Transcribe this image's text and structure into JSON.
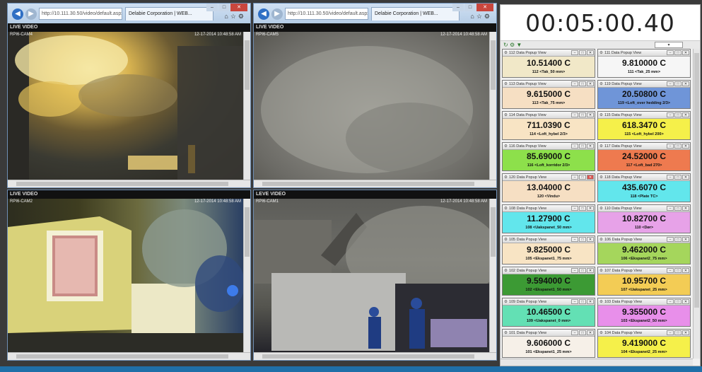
{
  "browser": {
    "address": "http://10.111.30.50/video/default.aspx",
    "tab_title": "Delabie Corporation | WEB...",
    "header": "LIVE VIDEO",
    "header_alt": "LEVE VIDEO"
  },
  "videos": [
    {
      "cam": "RPI6-CAM4",
      "stamp": "12-17-2014 10:48:58 AM"
    },
    {
      "cam": "RPI6-CAM5",
      "stamp": "12-17-2014 10:48:58 AM"
    },
    {
      "cam": "RPI6-CAM2",
      "stamp": "12-17-2014 10:48:58 AM"
    },
    {
      "cam": "RPI6-CAM1",
      "stamp": "12-17-2014 10:48:58 AM"
    }
  ],
  "timer": "00:05:00.40",
  "colors": {
    "taskbar": "#1f6fa8",
    "browser_frame": "#6f8fb5"
  },
  "readings": [
    {
      "header": "112 Data Popup View",
      "value": "10.51400 C",
      "label": "112 <Tak_50 mm>",
      "color": "#f1e8c8"
    },
    {
      "header": "111 Data Popup View",
      "value": "9.810000 C",
      "label": "111 <Tak_25 mm>",
      "color": "#f6f6f6"
    },
    {
      "header": "113 Data Popup View",
      "value": "9.615000 C",
      "label": "113 <Tak_75 mm>",
      "color": "#f6dfc3"
    },
    {
      "header": "119 Data Popup View",
      "value": "20.50800 C",
      "label": "119 <Loft_over hedding 2/3>",
      "color": "#6f95d8"
    },
    {
      "header": "114 Data Popup View",
      "value": "711.0390 C",
      "label": "114 <Loft_hybel 2/3>",
      "color": "#f8e4c4"
    },
    {
      "header": "115 Data Popup View",
      "value": "618.3470 C",
      "label": "115 <Loft_hybel 200>",
      "color": "#f5f04a"
    },
    {
      "header": "116 Data Popup View",
      "value": "85.69000 C",
      "label": "116 <Loft_korridor 2/3>",
      "color": "#8de04b"
    },
    {
      "header": "117 Data Popup View",
      "value": "24.52000 C",
      "label": "117 <Loft_bad 270>",
      "color": "#ee7a4f"
    },
    {
      "header": "120 Data Popup View",
      "value": "13.04000 C",
      "label": "120 <Vindu>",
      "color": "#f6dfc3"
    },
    {
      "header": "118 Data Popup View",
      "value": "435.6070 C",
      "label": "118 <Plate TC>",
      "color": "#62e6ec"
    },
    {
      "header": "108 Data Popup View",
      "value": "11.27900 C",
      "label": "108 <Uakspanet_50 mm>",
      "color": "#62e6ec"
    },
    {
      "header": "110 Data Popup View",
      "value": "10.82700 C",
      "label": "110 <Dør>",
      "color": "#e7a2e8"
    },
    {
      "header": "105 Data Popup View",
      "value": "9.825000 C",
      "label": "105 <Ekspanet1_75 mm>",
      "color": "#f8e4c4"
    },
    {
      "header": "106 Data Popup View",
      "value": "9.462000 C",
      "label": "106 <Ekspanet2_75 mm>",
      "color": "#a5d65c"
    },
    {
      "header": "102 Data Popup View",
      "value": "9.594000 C",
      "label": "102 <Ekspanet1_50 mm>",
      "color": "#3c9a34"
    },
    {
      "header": "107 Data Popup View",
      "value": "10.95700 C",
      "label": "107 <Uakspanet_25 mm>",
      "color": "#f3cc55"
    },
    {
      "header": "109 Data Popup View",
      "value": "10.46500 C",
      "label": "109 <Uakspanet_0 mm>",
      "color": "#63e0b4"
    },
    {
      "header": "103 Data Popup View",
      "value": "9.355000 C",
      "label": "103 <Ekspanet2_50 mm>",
      "color": "#e88fea"
    },
    {
      "header": "101 Data Popup View",
      "value": "9.606000 C",
      "label": "101 <Ekspanet1_25 mm>",
      "color": "#f6f0e8"
    },
    {
      "header": "104 Data Popup View",
      "value": "9.419000 C",
      "label": "104 <Ekspanet2_25 mm>",
      "color": "#f5f04a"
    }
  ]
}
